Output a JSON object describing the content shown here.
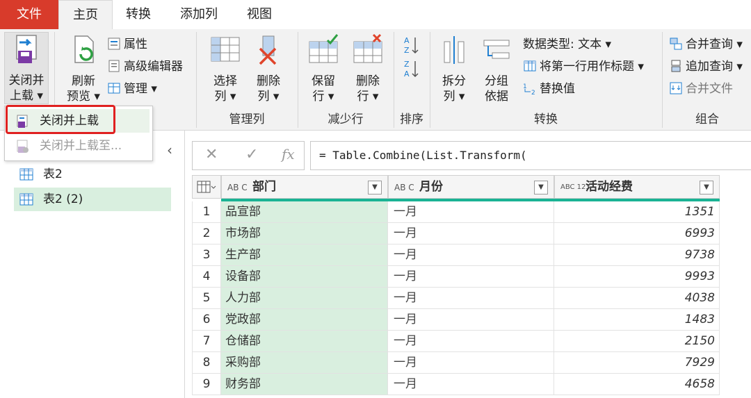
{
  "tabs": {
    "file": "文件",
    "home": "主页",
    "transform": "转换",
    "add_column": "添加列",
    "view": "视图"
  },
  "ribbon": {
    "close_load": {
      "line1": "关闭并",
      "line2": "上载 ▾"
    },
    "refresh": {
      "line1": "刷新",
      "line2": "预览 ▾"
    },
    "properties": "属性",
    "advanced_editor": "高级编辑器",
    "manage": "管理 ▾",
    "choose_cols": {
      "line1": "选择",
      "line2": "列 ▾"
    },
    "remove_cols": {
      "line1": "删除",
      "line2": "列 ▾"
    },
    "keep_rows": {
      "line1": "保留",
      "line2": "行 ▾"
    },
    "remove_rows": {
      "line1": "删除",
      "line2": "行 ▾"
    },
    "split_col": {
      "line1": "拆分",
      "line2": "列 ▾"
    },
    "group_by": {
      "line1": "分组",
      "line2": "依据"
    },
    "data_type": "数据类型: 文本 ▾",
    "first_row_header": "将第一行用作标题 ▾",
    "replace_values": "替换值",
    "merge_queries": "合并查询 ▾",
    "append_queries": "追加查询 ▾",
    "combine_files": "合并文件",
    "group_labels": {
      "manage_cols": "管理列",
      "reduce_rows": "减少行",
      "sort": "排序",
      "transform": "转换",
      "combine": "组合"
    }
  },
  "menu": {
    "close_load": "关闭并上载",
    "close_load_to": "关闭并上载至..."
  },
  "queries": [
    {
      "name": "表2",
      "selected": false
    },
    {
      "name": "表2 (2)",
      "selected": true
    }
  ],
  "formula": {
    "fx": "fx",
    "text": "= Table.Combine(List.Transform("
  },
  "table": {
    "columns": [
      {
        "type_icon": "AB C",
        "name": "部门"
      },
      {
        "type_icon": "AB C",
        "name": "月份"
      },
      {
        "type_icon": "ABC 123",
        "name": "活动经费"
      }
    ],
    "rows": [
      {
        "idx": "1",
        "dept": "品宣部",
        "month": "一月",
        "fee": "1351"
      },
      {
        "idx": "2",
        "dept": "市场部",
        "month": "一月",
        "fee": "6993"
      },
      {
        "idx": "3",
        "dept": "生产部",
        "month": "一月",
        "fee": "9738"
      },
      {
        "idx": "4",
        "dept": "设备部",
        "month": "一月",
        "fee": "9993"
      },
      {
        "idx": "5",
        "dept": "人力部",
        "month": "一月",
        "fee": "4038"
      },
      {
        "idx": "6",
        "dept": "党政部",
        "month": "一月",
        "fee": "1483"
      },
      {
        "idx": "7",
        "dept": "仓储部",
        "month": "一月",
        "fee": "2150"
      },
      {
        "idx": "8",
        "dept": "采购部",
        "month": "一月",
        "fee": "7929"
      },
      {
        "idx": "9",
        "dept": "财务部",
        "month": "一月",
        "fee": "4658"
      }
    ]
  },
  "colors": {
    "file_tab": "#d83b2b",
    "selected_green": "#d9efdf",
    "quality_bar": "#1ab394",
    "highlight_box": "#e02020"
  }
}
